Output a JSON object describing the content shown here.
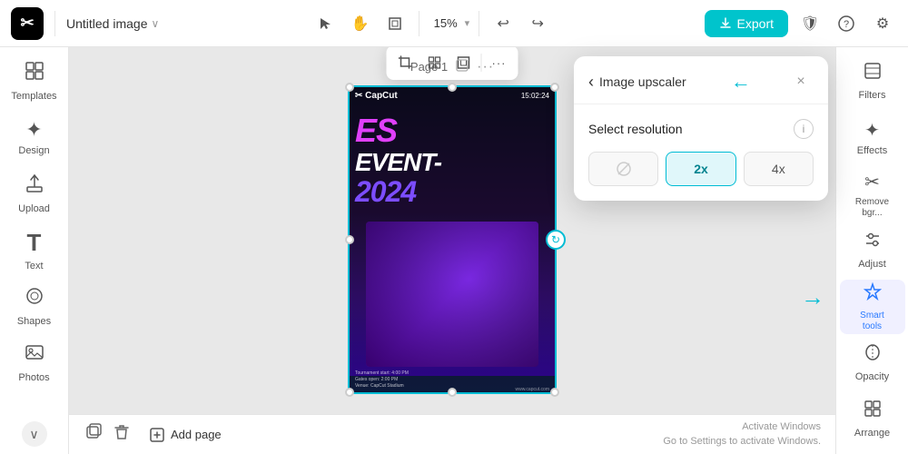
{
  "app": {
    "logo": "✂",
    "title": "Untitled image",
    "chevron": "∨"
  },
  "toolbar": {
    "select_tool": "▶",
    "hand_tool": "✋",
    "frame_tool": "⊡",
    "zoom_value": "15%",
    "zoom_chevron": "∨",
    "undo": "↩",
    "redo": "↪",
    "export_label": "Export",
    "export_icon": "↑",
    "shield_icon": "🛡",
    "help_icon": "?",
    "settings_icon": "⚙"
  },
  "sidebar": {
    "items": [
      {
        "id": "templates",
        "label": "Templates",
        "icon": "⊞"
      },
      {
        "id": "design",
        "label": "Design",
        "icon": "✦"
      },
      {
        "id": "upload",
        "label": "Upload",
        "icon": "⬆"
      },
      {
        "id": "text",
        "label": "Text",
        "icon": "T"
      },
      {
        "id": "shapes",
        "label": "Shapes",
        "icon": "◎"
      },
      {
        "id": "photos",
        "label": "Photos",
        "icon": "🖼"
      }
    ],
    "bottom": {
      "chevron": "∨"
    }
  },
  "canvas": {
    "page_label": "Page 1",
    "page_icon": "⊡",
    "more_icon": "•••",
    "bottom": {
      "duplicate_icon": "⊡",
      "delete_icon": "🗑",
      "add_page_icon": "⊡",
      "add_page_label": "Add page"
    },
    "watermark": {
      "line1": "Activate Windows",
      "line2": "Go to Settings to activate Windows."
    }
  },
  "floating_toolbar": {
    "icon1": "⊡",
    "icon2": "⊞",
    "icon3": "⊡",
    "more": "•••"
  },
  "poster": {
    "brand": "✂ CapCut",
    "time": "15:02:24",
    "line1": "ES",
    "line2": "EVENT-",
    "line3": "2024",
    "info": "Tournament start: 4:00 PM\nGates open: 2:00 PM\nVenue: CapCut Stadium",
    "website": "www.capcut.com"
  },
  "right_panel": {
    "items": [
      {
        "id": "filters",
        "label": "Filters",
        "icon": "⊞"
      },
      {
        "id": "effects",
        "label": "Effects",
        "icon": "✦"
      },
      {
        "id": "remove-bg",
        "label": "Remove\nbgr...",
        "icon": "✂"
      },
      {
        "id": "adjust",
        "label": "Adjust",
        "icon": "⊟"
      },
      {
        "id": "smart-tools",
        "label": "Smart\ntools",
        "icon": "✦",
        "active": true
      },
      {
        "id": "opacity",
        "label": "Opacity",
        "icon": "◉"
      },
      {
        "id": "arrange",
        "label": "Arrange",
        "icon": "⊞"
      }
    ]
  },
  "upscaler": {
    "back_icon": "‹",
    "back_label": "Image upscaler",
    "arrow_icon": "←",
    "close_icon": "×",
    "section_title": "Select resolution",
    "info_icon": "i",
    "options": [
      {
        "id": "disabled",
        "label": "⊘",
        "active": false,
        "disabled": true
      },
      {
        "id": "2x",
        "label": "2x",
        "active": true
      },
      {
        "id": "4x",
        "label": "4x",
        "active": false
      }
    ]
  }
}
